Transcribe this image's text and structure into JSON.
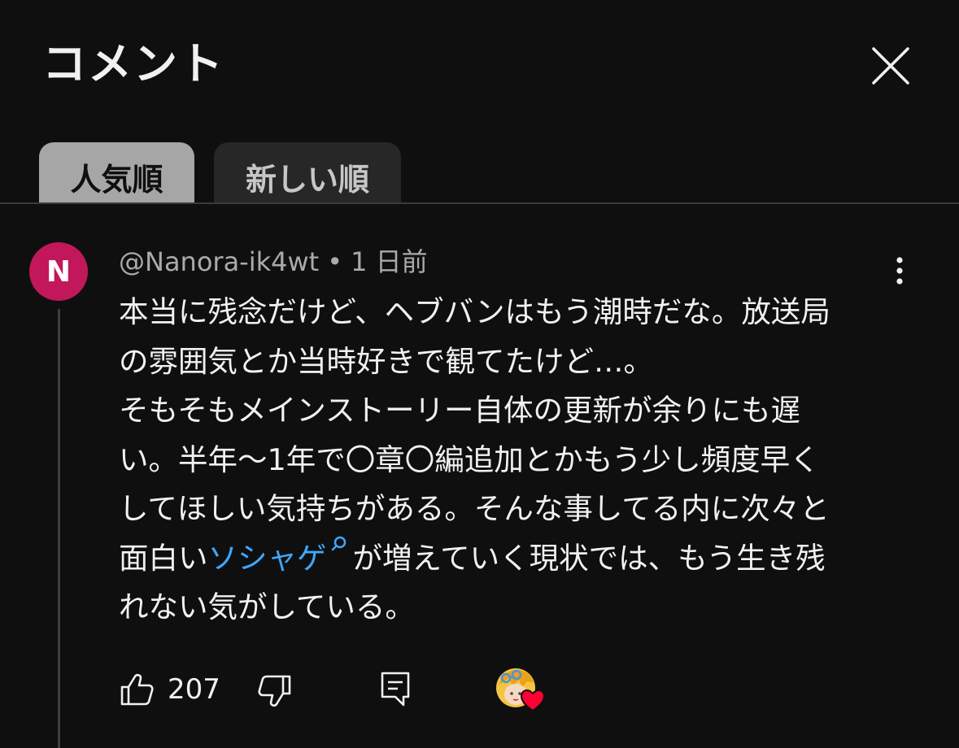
{
  "header": {
    "title": "コメント",
    "close_icon": "close-icon"
  },
  "tabs": [
    {
      "label": "人気順",
      "selected": true
    },
    {
      "label": "新しい順",
      "selected": false
    }
  ],
  "comment": {
    "avatar_letter": "N",
    "avatar_color": "#c2185b",
    "author": "@Nanora-ik4wt",
    "separator": "•",
    "time": "1 日前",
    "text_lines": [
      "本当に残念だけど、ヘブバンはもう潮時だな。放送局",
      "の雰囲気とか当時好きで観てたけど…。",
      "そもそもメインストーリー自体の更新が余りにも遅",
      "い。半年〜1年で〇章〇編追加とかもう少し頻度早く",
      "してほしい気持ちがある。そんな事してる内に次々と"
    ],
    "line6_prefix": "面白い",
    "link_text": "ソシャゲ",
    "line6_suffix": "が増えていく現状では、もう生き残",
    "line7": "れない気がしている。",
    "like_count": "207",
    "link_color": "#3ea6ff",
    "heart_color": "#ff0033"
  },
  "icons": {
    "like": "thumbs-up-icon",
    "dislike": "thumbs-down-icon",
    "reply": "reply-icon",
    "more": "more-vert-icon",
    "search": "search-icon"
  }
}
